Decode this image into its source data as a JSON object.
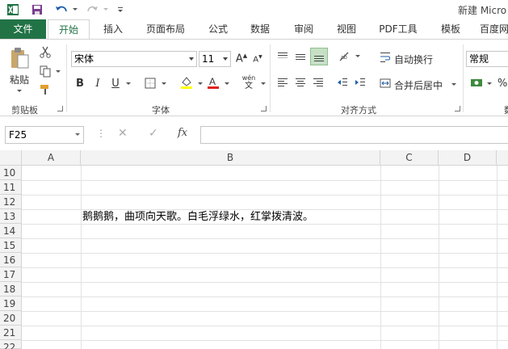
{
  "title": "新建 Micro",
  "tabs": {
    "file": "文件",
    "home": "开始",
    "insert": "插入",
    "page_layout": "页面布局",
    "formulas": "公式",
    "data": "数据",
    "review": "审阅",
    "view": "视图",
    "pdf": "PDF工具",
    "template": "模板",
    "baidu": "百度网"
  },
  "ribbon": {
    "clipboard": {
      "paste_label": "粘贴",
      "group_label": "剪贴板"
    },
    "font": {
      "font_name": "宋体",
      "font_size": "11",
      "bold": "B",
      "italic": "I",
      "underline": "U",
      "font_color_letter": "A",
      "phonetic": "wén",
      "group_label": "字体"
    },
    "alignment": {
      "wrap_text": "自动换行",
      "merge_center": "合并后居中",
      "group_label": "对齐方式"
    },
    "number": {
      "format": "常规",
      "percent": "%",
      "group_label_partial": "数"
    }
  },
  "formula_bar": {
    "name_box": "F25",
    "fx_label": "fx",
    "value": ""
  },
  "grid": {
    "columns": [
      "A",
      "B",
      "C",
      "D"
    ],
    "rows": [
      "10",
      "11",
      "12",
      "13",
      "14",
      "15",
      "16",
      "17",
      "18",
      "19",
      "20",
      "21",
      "22"
    ],
    "cell_B13": "鹅鹅鹅，曲项向天歌。白毛浮绿水，红掌拨清波。"
  },
  "colors": {
    "accent_green": "#217346",
    "font_color_bar": "#e02020",
    "highlight_bar": "#ffff00"
  }
}
